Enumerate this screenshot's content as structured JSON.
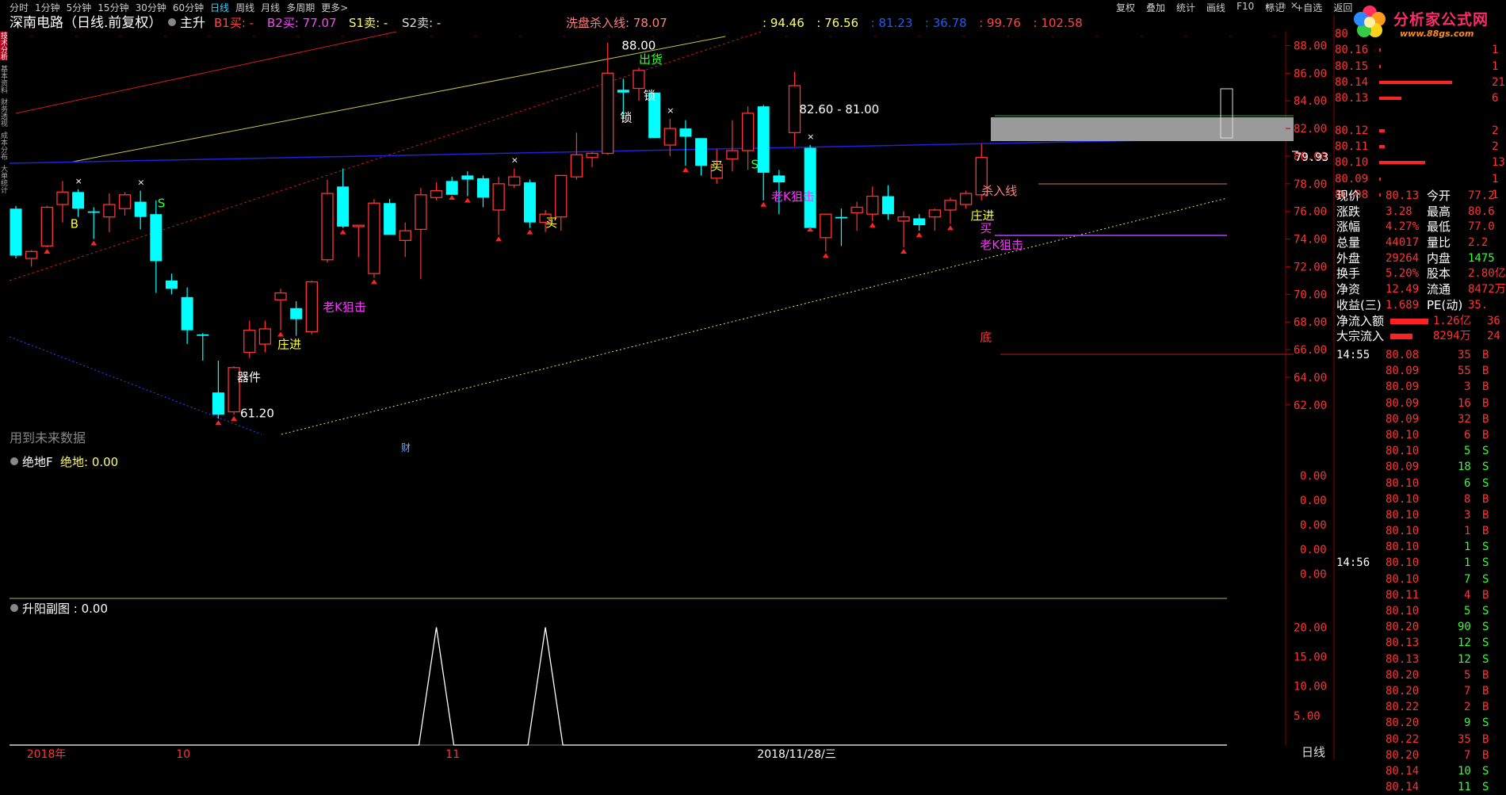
{
  "toolbar": {
    "periods": [
      "分时",
      "1分钟",
      "5分钟",
      "15分钟",
      "30分钟",
      "60分钟",
      "日线",
      "周线",
      "月线",
      "多周期",
      "更多>"
    ],
    "active_period": "日线",
    "menu": [
      "复权",
      "叠加",
      "统计",
      "画线",
      "F10",
      "标记",
      "+自选",
      "返回"
    ]
  },
  "logo": {
    "text": "分析家公式网",
    "url": "www.88gs.com"
  },
  "main_header": {
    "title": "深南电路（日线.前复权）",
    "indicator": "主升",
    "b1": "B1买: -",
    "b2": "B2买: 77.07",
    "s1": "S1卖: -",
    "s2": "S2卖: -",
    "wash_line": "洗盘杀入线: 78.07",
    "values": [
      {
        "text": ": 94.46",
        "color": "#ffff66"
      },
      {
        "text": ": 76.56",
        "color": "#ffff66"
      },
      {
        "text": ": 81.23",
        "color": "#1f5cff"
      },
      {
        "text": ": 36.78",
        "color": "#1f5cff"
      },
      {
        "text": ": 99.76",
        "color": "#ff4444"
      },
      {
        "text": ": 102.58",
        "color": "#ff4444"
      }
    ]
  },
  "main_axis": [
    "88.00",
    "86.00",
    "84.00",
    "82.00",
    "80.00",
    "78.00",
    "76.00",
    "74.00",
    "72.00",
    "70.00",
    "68.00",
    "66.00",
    "64.00",
    "62.00"
  ],
  "current_price_tag": "79.93",
  "chart_data": {
    "type": "candlestick",
    "ylim": [
      60.5,
      88.6
    ],
    "candles": [
      {
        "o": 76.2,
        "h": 76.4,
        "l": 72.6,
        "c": 72.8
      },
      {
        "o": 72.6,
        "h": 73.2,
        "l": 72.0,
        "c": 73.1
      },
      {
        "o": 73.5,
        "h": 76.4,
        "l": 73.4,
        "c": 76.3
      },
      {
        "o": 76.5,
        "h": 78.2,
        "l": 75.2,
        "c": 77.4
      },
      {
        "o": 77.4,
        "h": 77.6,
        "l": 75.6,
        "c": 76.2
      },
      {
        "o": 76.0,
        "h": 76.3,
        "l": 74.0,
        "c": 75.9
      },
      {
        "o": 75.6,
        "h": 77.3,
        "l": 74.5,
        "c": 76.5
      },
      {
        "o": 76.2,
        "h": 77.4,
        "l": 75.7,
        "c": 77.2
      },
      {
        "o": 76.7,
        "h": 77.5,
        "l": 74.7,
        "c": 75.6
      },
      {
        "o": 75.8,
        "h": 76.8,
        "l": 70.1,
        "c": 72.4
      },
      {
        "o": 71.0,
        "h": 71.5,
        "l": 70.0,
        "c": 70.4
      },
      {
        "o": 69.8,
        "h": 70.5,
        "l": 66.4,
        "c": 67.4
      },
      {
        "o": 67.1,
        "h": 67.2,
        "l": 65.2,
        "c": 67.0
      },
      {
        "o": 62.9,
        "h": 65.2,
        "l": 61.0,
        "c": 61.3
      },
      {
        "o": 61.5,
        "h": 64.8,
        "l": 61.3,
        "c": 64.7
      },
      {
        "o": 65.8,
        "h": 68.1,
        "l": 65.4,
        "c": 67.4
      },
      {
        "o": 66.4,
        "h": 68.1,
        "l": 65.8,
        "c": 67.5
      },
      {
        "o": 69.6,
        "h": 70.4,
        "l": 67.4,
        "c": 70.1
      },
      {
        "o": 69.0,
        "h": 69.5,
        "l": 67.0,
        "c": 68.2
      },
      {
        "o": 67.3,
        "h": 71.0,
        "l": 67.1,
        "c": 70.9
      },
      {
        "o": 72.5,
        "h": 78.3,
        "l": 72.3,
        "c": 77.3
      },
      {
        "o": 77.8,
        "h": 79.1,
        "l": 74.8,
        "c": 74.9
      },
      {
        "o": 74.9,
        "h": 75.0,
        "l": 72.7,
        "c": 75.0
      },
      {
        "o": 71.5,
        "h": 76.9,
        "l": 71.2,
        "c": 76.6
      },
      {
        "o": 76.6,
        "h": 76.9,
        "l": 74.6,
        "c": 74.3
      },
      {
        "o": 73.9,
        "h": 75.2,
        "l": 72.7,
        "c": 74.6
      },
      {
        "o": 74.7,
        "h": 77.7,
        "l": 71.1,
        "c": 77.2
      },
      {
        "o": 77.0,
        "h": 78.1,
        "l": 76.8,
        "c": 77.5
      },
      {
        "o": 78.2,
        "h": 78.5,
        "l": 77.3,
        "c": 77.2
      },
      {
        "o": 78.6,
        "h": 78.9,
        "l": 77.1,
        "c": 78.3
      },
      {
        "o": 78.4,
        "h": 78.6,
        "l": 76.3,
        "c": 77.0
      },
      {
        "o": 76.1,
        "h": 78.5,
        "l": 74.3,
        "c": 78.0
      },
      {
        "o": 77.9,
        "h": 79.1,
        "l": 77.7,
        "c": 78.5
      },
      {
        "o": 78.1,
        "h": 78.3,
        "l": 74.8,
        "c": 75.2
      },
      {
        "o": 75.2,
        "h": 76.1,
        "l": 74.5,
        "c": 75.8
      },
      {
        "o": 75.6,
        "h": 78.4,
        "l": 74.6,
        "c": 78.6
      },
      {
        "o": 78.5,
        "h": 81.7,
        "l": 78.3,
        "c": 80.1
      },
      {
        "o": 79.9,
        "h": 80.3,
        "l": 79.2,
        "c": 80.2
      },
      {
        "o": 80.2,
        "h": 88.2,
        "l": 80.1,
        "c": 86.0
      },
      {
        "o": 84.8,
        "h": 85.6,
        "l": 82.7,
        "c": 84.6
      },
      {
        "o": 84.9,
        "h": 86.4,
        "l": 84.0,
        "c": 86.2
      },
      {
        "o": 84.6,
        "h": 84.5,
        "l": 81.3,
        "c": 81.3
      },
      {
        "o": 80.8,
        "h": 82.7,
        "l": 80.0,
        "c": 82.0
      },
      {
        "o": 82.0,
        "h": 82.6,
        "l": 79.3,
        "c": 81.4
      },
      {
        "o": 81.3,
        "h": 81.3,
        "l": 78.6,
        "c": 79.3
      },
      {
        "o": 78.4,
        "h": 80.5,
        "l": 78.0,
        "c": 79.4
      },
      {
        "o": 79.8,
        "h": 82.6,
        "l": 78.9,
        "c": 80.4
      },
      {
        "o": 80.4,
        "h": 83.6,
        "l": 79.0,
        "c": 83.1
      },
      {
        "o": 83.6,
        "h": 83.7,
        "l": 76.8,
        "c": 78.8
      },
      {
        "o": 78.6,
        "h": 79.0,
        "l": 75.8,
        "c": 78.1
      },
      {
        "o": 81.7,
        "h": 86.1,
        "l": 80.7,
        "c": 85.1
      },
      {
        "o": 80.6,
        "h": 80.8,
        "l": 75.0,
        "c": 74.8
      },
      {
        "o": 74.1,
        "h": 75.8,
        "l": 73.1,
        "c": 75.8
      },
      {
        "o": 75.6,
        "h": 76.2,
        "l": 73.5,
        "c": 75.5
      },
      {
        "o": 75.9,
        "h": 76.7,
        "l": 74.6,
        "c": 76.3
      },
      {
        "o": 75.8,
        "h": 77.8,
        "l": 75.3,
        "c": 77.1
      },
      {
        "o": 77.1,
        "h": 77.9,
        "l": 75.4,
        "c": 75.8
      },
      {
        "o": 75.3,
        "h": 76.0,
        "l": 73.4,
        "c": 75.6
      },
      {
        "o": 75.5,
        "h": 75.8,
        "l": 74.6,
        "c": 75.0
      },
      {
        "o": 75.6,
        "h": 76.2,
        "l": 74.6,
        "c": 76.1
      },
      {
        "o": 76.1,
        "h": 77.0,
        "l": 75.1,
        "c": 76.8
      },
      {
        "o": 76.5,
        "h": 77.5,
        "l": 76.2,
        "c": 77.3
      },
      {
        "o": 77.2,
        "h": 80.9,
        "l": 76.8,
        "c": 79.9
      }
    ],
    "labels": [
      {
        "text": "88.00",
        "color": "#ffffff",
        "price": 87.7,
        "bar": 38.9
      },
      {
        "text": "出货",
        "color": "#33ff33",
        "price": 86.7,
        "bar": 40.0
      },
      {
        "text": "锁",
        "color": "#ffffff",
        "price": 84.1,
        "bar": 40.3
      },
      {
        "text": "锁",
        "color": "#ffffff",
        "price": 82.5,
        "bar": 38.8
      },
      {
        "text": "82.60 - 81.00",
        "color": "#ffffff",
        "price": 83.1,
        "bar": 50.3
      },
      {
        "text": "买",
        "color": "#ffff33",
        "price": 79.0,
        "bar": 44.6
      },
      {
        "text": "S",
        "color": "#33ff33",
        "price": 79.1,
        "bar": 47.2
      },
      {
        "text": "老K狙击",
        "color": "#ff33ff",
        "price": 76.8,
        "bar": 48.5
      },
      {
        "text": "杀入线",
        "color": "#ff8080",
        "price": 77.2,
        "bar": 62.0
      },
      {
        "text": "庄进",
        "color": "#ffff33",
        "price": 75.4,
        "bar": 61.3
      },
      {
        "text": "买",
        "color": "#ff33ff",
        "price": 74.5,
        "bar": 61.9
      },
      {
        "text": "老K狙击",
        "color": "#ff33ff",
        "price": 73.3,
        "bar": 61.9
      },
      {
        "text": "底",
        "color": "#ff3333",
        "price": 66.6,
        "bar": 61.9
      },
      {
        "text": "买",
        "color": "#ffff33",
        "price": 74.9,
        "bar": 34.0
      },
      {
        "text": "S",
        "color": "#33ff33",
        "price": 76.3,
        "bar": 9.1
      },
      {
        "text": "老K狙击",
        "color": "#ff33ff",
        "price": 68.8,
        "bar": 19.7
      },
      {
        "text": "庄进",
        "color": "#ffff33",
        "price": 66.1,
        "bar": 16.8
      },
      {
        "text": "器件",
        "color": "#ffffff",
        "price": 63.7,
        "bar": 14.2
      },
      {
        "text": "61.20",
        "color": "#ffffff",
        "price": 61.1,
        "bar": 14.4
      },
      {
        "text": "B",
        "color": "#ffff33",
        "price": 74.8,
        "bar": 3.5
      }
    ],
    "notice": "用到未来数据",
    "fin_marker": "财"
  },
  "sub1": {
    "title": "绝地F",
    "label": "绝地: 0.00",
    "axis": [
      "0.00",
      "0.00",
      "0.00",
      "0.00",
      "0.00"
    ]
  },
  "sub2": {
    "title": "升阳副图 : 0.00",
    "axis": [
      "20.00",
      "15.00",
      "10.00",
      "5.00"
    ],
    "series": [
      {
        "x": 27,
        "y": 20
      },
      {
        "x": 34,
        "y": 20
      }
    ]
  },
  "xaxis": [
    {
      "text": "2018年",
      "bar": 0.8
    },
    {
      "text": "10",
      "bar": 10.4
    },
    {
      "text": "11",
      "bar": 27.7
    },
    {
      "text": "2018/11/28/三",
      "bar": 47.7
    }
  ],
  "orderbook": [
    {
      "price": "80",
      "vol": "",
      "bar": 0
    },
    {
      "price": "80.16",
      "vol": "1",
      "bar": 0.02
    },
    {
      "price": "80.15",
      "vol": "1",
      "bar": 0.02
    },
    {
      "price": "80.14",
      "vol": "21",
      "bar": 0.92
    },
    {
      "price": "80.13",
      "vol": "6",
      "bar": 0.28
    },
    {
      "price": "",
      "vol": "",
      "bar": 0
    },
    {
      "price": "80.12",
      "vol": "2",
      "bar": 0.07
    },
    {
      "price": "80.11",
      "vol": "2",
      "bar": 0.07
    },
    {
      "price": "80.10",
      "vol": "13",
      "bar": 0.58
    },
    {
      "price": "80.09",
      "vol": "1",
      "bar": 0.02
    },
    {
      "price": "80.08",
      "vol": "1",
      "bar": 0.02
    }
  ],
  "quote": [
    {
      "l1": "现价",
      "v1": "80.13",
      "l2": "今开",
      "v2": "77.2"
    },
    {
      "l1": "涨跌",
      "v1": "3.28",
      "l2": "最高",
      "v2": "80.6"
    },
    {
      "l1": "涨幅",
      "v1": "4.27%",
      "l2": "最低",
      "v2": "77.0"
    },
    {
      "l1": "总量",
      "v1": "44017",
      "l2": "量比",
      "v2": "2.2"
    },
    {
      "l1": "外盘",
      "v1": "29264",
      "l2": "内盘",
      "v2": "1475"
    },
    {
      "l1": "换手",
      "v1": "5.20%",
      "l2": "股本",
      "v2": "2.80亿"
    },
    {
      "l1": "净资",
      "v1": "12.49",
      "l2": "流通",
      "v2": "8472万"
    },
    {
      "l1": "收益(三)",
      "v1": "1.689",
      "l2": "PE(动)",
      "v2": "35."
    },
    {
      "l1": "净流入额",
      "v1": "1.26亿",
      "l2": "",
      "v2": "36"
    },
    {
      "l1": "大宗流入",
      "v1": "8294万",
      "l2": "",
      "v2": "24"
    }
  ],
  "trades": [
    {
      "time": "14:55",
      "price": "80.08",
      "vol": "35",
      "side": "B"
    },
    {
      "time": "",
      "price": "80.09",
      "vol": "55",
      "side": "B"
    },
    {
      "time": "",
      "price": "80.09",
      "vol": "3",
      "side": "B"
    },
    {
      "time": "",
      "price": "80.09",
      "vol": "16",
      "side": "B"
    },
    {
      "time": "",
      "price": "80.09",
      "vol": "32",
      "side": "B"
    },
    {
      "time": "",
      "price": "80.10",
      "vol": "6",
      "side": "B"
    },
    {
      "time": "",
      "price": "80.10",
      "vol": "5",
      "side": "S"
    },
    {
      "time": "",
      "price": "80.09",
      "vol": "18",
      "side": "S"
    },
    {
      "time": "",
      "price": "80.10",
      "vol": "6",
      "side": "S"
    },
    {
      "time": "",
      "price": "80.10",
      "vol": "8",
      "side": "B"
    },
    {
      "time": "",
      "price": "80.10",
      "vol": "3",
      "side": "B"
    },
    {
      "time": "",
      "price": "80.10",
      "vol": "1",
      "side": "B"
    },
    {
      "time": "",
      "price": "80.10",
      "vol": "1",
      "side": "S"
    },
    {
      "time": "14:56",
      "price": "80.10",
      "vol": "1",
      "side": "S"
    },
    {
      "time": "",
      "price": "80.10",
      "vol": "7",
      "side": "S"
    },
    {
      "time": "",
      "price": "80.11",
      "vol": "4",
      "side": "B"
    },
    {
      "time": "",
      "price": "80.10",
      "vol": "5",
      "side": "S"
    },
    {
      "time": "",
      "price": "80.20",
      "vol": "90",
      "side": "S"
    },
    {
      "time": "",
      "price": "80.13",
      "vol": "12",
      "side": "S"
    },
    {
      "time": "",
      "price": "80.13",
      "vol": "12",
      "side": "S"
    },
    {
      "time": "",
      "price": "80.20",
      "vol": "5",
      "side": "B"
    },
    {
      "time": "",
      "price": "80.20",
      "vol": "7",
      "side": "B"
    },
    {
      "time": "",
      "price": "80.22",
      "vol": "2",
      "side": "B"
    },
    {
      "time": "",
      "price": "80.20",
      "vol": "9",
      "side": "S"
    },
    {
      "time": "",
      "price": "80.22",
      "vol": "35",
      "side": "B"
    },
    {
      "time": "",
      "price": "80.20",
      "vol": "7",
      "side": "B"
    },
    {
      "time": "",
      "price": "80.14",
      "vol": "10",
      "side": "S"
    },
    {
      "time": "",
      "price": "80.14",
      "vol": "11",
      "side": "S"
    }
  ],
  "side_label": "日线",
  "left_tabs": [
    "技术分析",
    "基本资料",
    "财务透视",
    "成本分布",
    "大单统计"
  ]
}
